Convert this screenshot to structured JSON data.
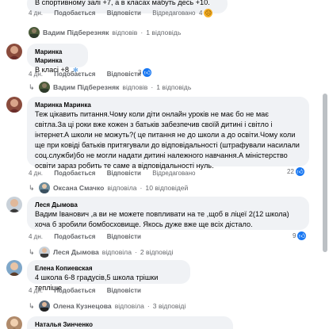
{
  "comments": [
    {
      "text": "В спортивному залі +7, а в класах мабуть десь +10.",
      "time": "4 дн.",
      "like": "Подобається",
      "reply": "Відповісти",
      "edited": "Відредаговано",
      "reaction_count": "4"
    },
    {
      "author": "Маринка Маринка",
      "text": "В класі +8 .",
      "time": "4 дн.",
      "like": "Подобається",
      "reply": "Відповісти",
      "edited": "",
      "reaction_count": "3"
    },
    {
      "author": "Маринка Маринка",
      "text": "Теж цікавить питання.Чому коли діти онлайн уроків не має бо не має світла.За ці роки вже кожен з батьків забезпечив своїй дитині і світло і інтернет.А школи не можуть?( це питання не до школи а до освіти.Чому коли ще при ковіді батьків притягували до відповідальності (штрафували насилали соц.служби)бо не могли надати дитині належного навчання.А міністерство освіти зараз робить те саме а відповідальності нуль.",
      "time": "4 дн.",
      "like": "Подобається",
      "reply": "Відповісти",
      "edited": "Відредаговано",
      "reaction_count": "22"
    },
    {
      "author": "Леся Дымова",
      "text": "Вадим Іванович ,а ви не можете повпливати на те ,щоб в ліцеї 2(12 школа) хоча б зробили бомбосховище. Якось дуже вже ще всіх дістало.",
      "time": "4 дн.",
      "like": "Подобається",
      "reply": "Відповісти",
      "edited": "",
      "reaction_count": "9"
    },
    {
      "author": "Елена Копиевская",
      "text": "4 школа 6-8 градусів,5 школа трішки тепліше",
      "time": "4 дн.",
      "like": "Подобається",
      "reply": "Відповісти",
      "edited": "",
      "reaction_count": ""
    },
    {
      "author": "Наталья Зинченко",
      "text": ""
    }
  ],
  "reply_threads": [
    {
      "name": "Вадим Підберезняк",
      "action": "відповів",
      "count": "1 відповідь"
    },
    {
      "name": "Вадим Підберезняк",
      "action": "відповів",
      "count": "1 відповідь"
    },
    {
      "name": "Оксана Смачко",
      "action": "відповіла",
      "count": "10 відповідей"
    },
    {
      "name": "Леся Дымова",
      "action": "відповіла",
      "count": "2 відповіді"
    },
    {
      "name": "Олена Кузнецова",
      "action": "відповіла",
      "count": "3 відповіді"
    }
  ],
  "separator": "·",
  "colors": {
    "like_blue": "#1877f2",
    "love_red": "#f33e58",
    "haha_yellow": "#f7b125",
    "bubble_bg": "#f0f2f5",
    "meta_gray": "#65676b"
  },
  "icons": {
    "like": "thumbs-up-icon",
    "love": "heart-icon",
    "haha": "laugh-icon",
    "reply": "reply-arrow-icon"
  }
}
